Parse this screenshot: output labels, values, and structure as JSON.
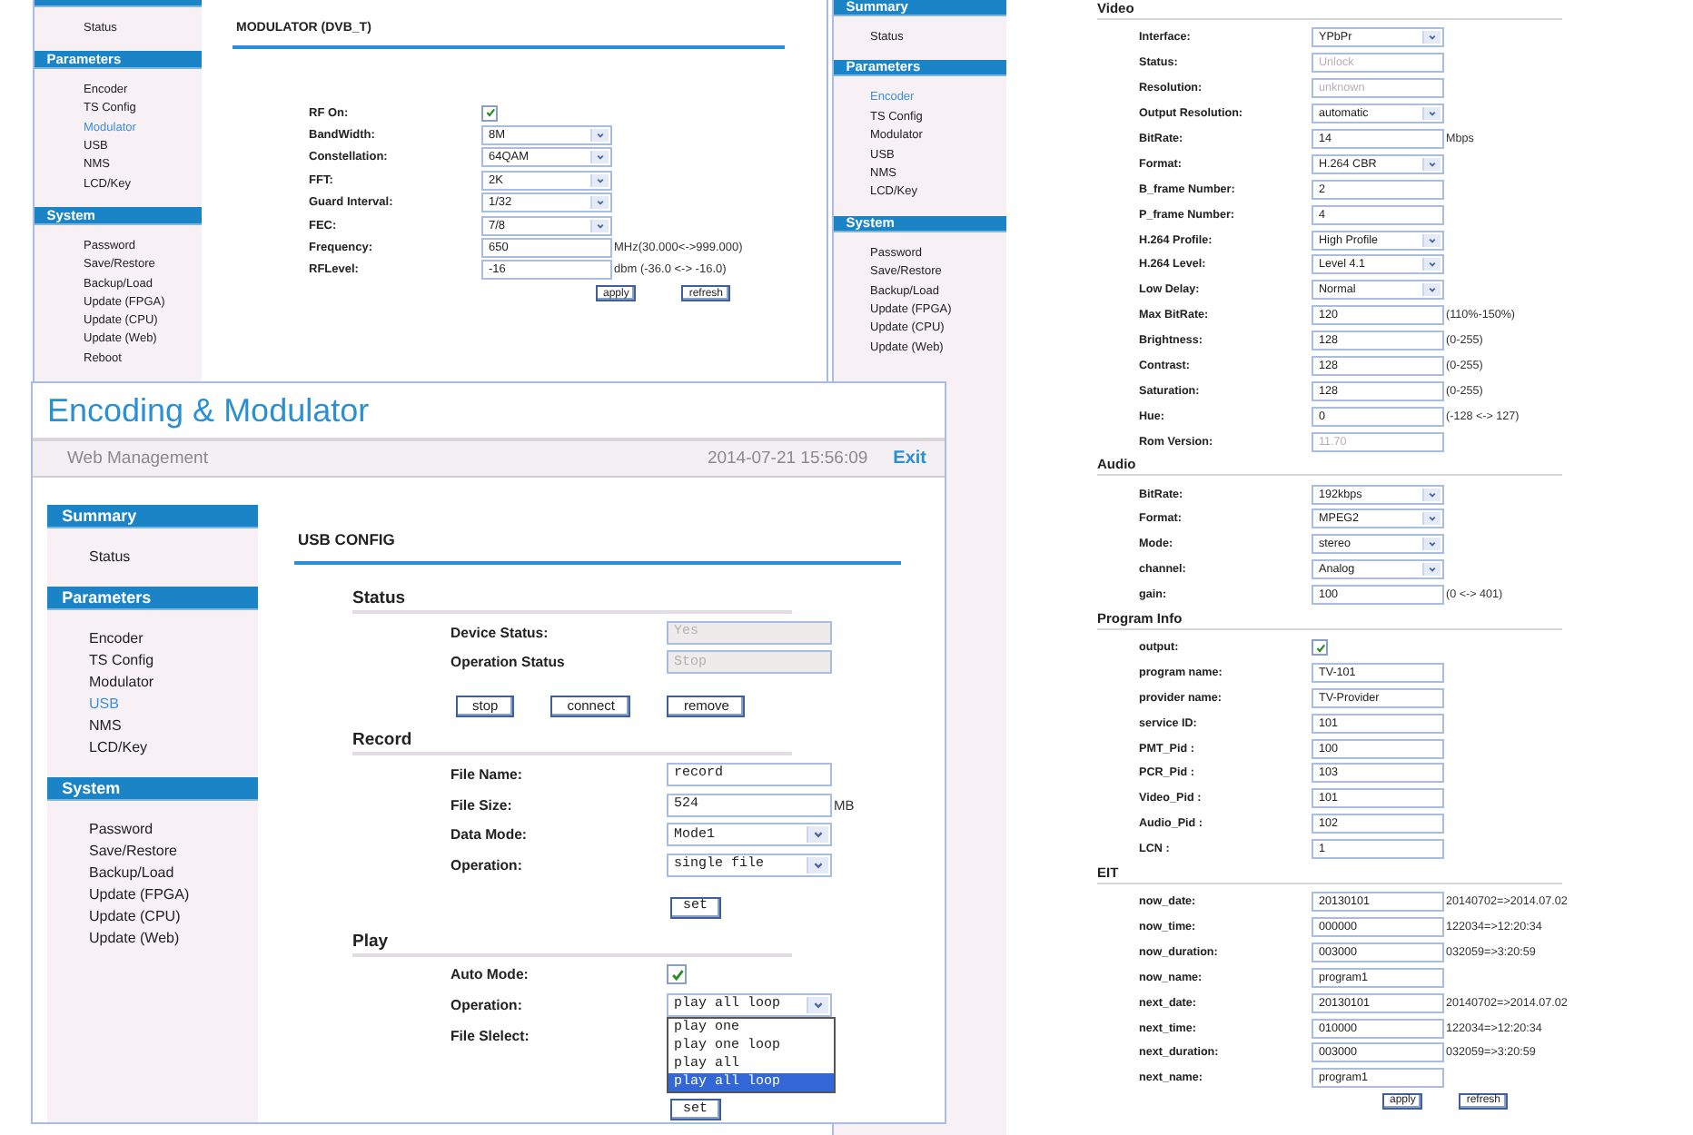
{
  "modulator_window": {
    "sidebar": [
      {
        "items": [
          {
            "label": "Status",
            "selected": false
          }
        ]
      },
      {
        "title": "Parameters",
        "items": [
          {
            "label": "Encoder",
            "selected": false
          },
          {
            "label": "TS Config",
            "selected": false
          },
          {
            "label": "Modulator",
            "selected": true
          },
          {
            "label": "USB",
            "selected": false
          },
          {
            "label": "NMS",
            "selected": false
          },
          {
            "label": "LCD/Key",
            "selected": false
          }
        ]
      },
      {
        "title": "System",
        "items": [
          {
            "label": "Password",
            "selected": false
          },
          {
            "label": "Save/Restore",
            "selected": false
          },
          {
            "label": "Backup/Load",
            "selected": false
          },
          {
            "label": "Update (FPGA)",
            "selected": false
          },
          {
            "label": "Update (CPU)",
            "selected": false
          },
          {
            "label": "Update (Web)",
            "selected": false
          },
          {
            "label": "Reboot",
            "selected": false
          }
        ]
      }
    ],
    "heading": "MODULATOR (DVB_T)",
    "fields": [
      {
        "kind": "checkbox",
        "label": "RF On:",
        "checked": true
      },
      {
        "kind": "select",
        "label": "BandWidth:",
        "value": "8M"
      },
      {
        "kind": "select",
        "label": "Constellation:",
        "value": "64QAM"
      },
      {
        "kind": "select",
        "label": "FFT:",
        "value": "2K"
      },
      {
        "kind": "select",
        "label": "Guard Interval:",
        "value": "1/32"
      },
      {
        "kind": "select",
        "label": "FEC:",
        "value": "7/8"
      },
      {
        "kind": "input",
        "label": "Frequency:",
        "value": "650",
        "hint": "MHz(30.000<->999.000)"
      },
      {
        "kind": "input",
        "label": "RFLevel:",
        "value": "-16",
        "hint": "dbm (-36.0 <-> -16.0)"
      }
    ],
    "buttons": [
      "apply",
      "refresh"
    ]
  },
  "encoder_window": {
    "sidebar": [
      {
        "title": "Summary",
        "items": [
          {
            "label": "Status",
            "selected": false
          }
        ]
      },
      {
        "title": "Parameters",
        "items": [
          {
            "label": "Encoder",
            "selected": true
          },
          {
            "label": "TS Config",
            "selected": false
          },
          {
            "label": "Modulator",
            "selected": false
          },
          {
            "label": "USB",
            "selected": false
          },
          {
            "label": "NMS",
            "selected": false
          },
          {
            "label": "LCD/Key",
            "selected": false
          }
        ]
      },
      {
        "title": "System",
        "items": [
          {
            "label": "Password",
            "selected": false
          },
          {
            "label": "Save/Restore",
            "selected": false
          },
          {
            "label": "Backup/Load",
            "selected": false
          },
          {
            "label": "Update (FPGA)",
            "selected": false
          },
          {
            "label": "Update (CPU)",
            "selected": false
          },
          {
            "label": "Update (Web)",
            "selected": false
          }
        ]
      }
    ],
    "groups": [
      {
        "title": "Video",
        "fields": [
          {
            "kind": "select",
            "label": "Interface:",
            "value": "YPbPr"
          },
          {
            "kind": "readonly",
            "label": "Status:",
            "value": "Unlock"
          },
          {
            "kind": "readonly",
            "label": "Resolution:",
            "value": "unknown"
          },
          {
            "kind": "select",
            "label": "Output Resolution:",
            "value": "automatic"
          },
          {
            "kind": "input",
            "label": "BitRate:",
            "value": "14",
            "hint": "Mbps"
          },
          {
            "kind": "select",
            "label": "Format:",
            "value": "H.264 CBR"
          },
          {
            "kind": "input",
            "label": "B_frame Number:",
            "value": "2"
          },
          {
            "kind": "input",
            "label": "P_frame Number:",
            "value": "4"
          },
          {
            "kind": "select",
            "label": "H.264 Profile:",
            "value": "High Profile"
          },
          {
            "kind": "select",
            "label": "H.264 Level:",
            "value": "Level 4.1"
          },
          {
            "kind": "select",
            "label": "Low Delay:",
            "value": "Normal"
          },
          {
            "kind": "input",
            "label": "Max BitRate:",
            "value": "120",
            "hint": "(110%-150%)"
          },
          {
            "kind": "input",
            "label": "Brightness:",
            "value": "128",
            "hint": "(0-255)"
          },
          {
            "kind": "input",
            "label": "Contrast:",
            "value": "128",
            "hint": "(0-255)"
          },
          {
            "kind": "input",
            "label": "Saturation:",
            "value": "128",
            "hint": "(0-255)"
          },
          {
            "kind": "input",
            "label": "Hue:",
            "value": "0",
            "hint": "(-128 <-> 127)"
          },
          {
            "kind": "readonly",
            "label": "Rom Version:",
            "value": "11.70"
          }
        ]
      },
      {
        "title": "Audio",
        "fields": [
          {
            "kind": "select",
            "label": "BitRate:",
            "value": "192kbps"
          },
          {
            "kind": "select",
            "label": "Format:",
            "value": "MPEG2"
          },
          {
            "kind": "select",
            "label": "Mode:",
            "value": "stereo"
          },
          {
            "kind": "select",
            "label": "channel:",
            "value": "Analog"
          },
          {
            "kind": "input",
            "label": "gain:",
            "value": "100",
            "hint": "(0 <-> 401)"
          }
        ]
      },
      {
        "title": "Program Info",
        "fields": [
          {
            "kind": "checkbox",
            "label": "output:",
            "checked": true
          },
          {
            "kind": "input",
            "label": "program name:",
            "value": "TV-101"
          },
          {
            "kind": "input",
            "label": "provider name:",
            "value": "TV-Provider"
          },
          {
            "kind": "input",
            "label": "service ID:",
            "value": "101"
          },
          {
            "kind": "input",
            "label": "PMT_Pid :",
            "value": "100"
          },
          {
            "kind": "input",
            "label": "PCR_Pid :",
            "value": "103"
          },
          {
            "kind": "input",
            "label": "Video_Pid :",
            "value": "101"
          },
          {
            "kind": "input",
            "label": "Audio_Pid :",
            "value": "102"
          },
          {
            "kind": "input",
            "label": "LCN :",
            "value": "1"
          }
        ]
      },
      {
        "title": "EIT",
        "fields": [
          {
            "kind": "input",
            "label": "now_date:",
            "value": "20130101",
            "hint": "20140702=>2014.07.02"
          },
          {
            "kind": "input",
            "label": "now_time:",
            "value": "000000",
            "hint": "122034=>12:20:34"
          },
          {
            "kind": "input",
            "label": "now_duration:",
            "value": "003000",
            "hint": "032059=>3:20:59"
          },
          {
            "kind": "input",
            "label": "now_name:",
            "value": "program1"
          },
          {
            "kind": "input",
            "label": "next_date:",
            "value": "20130101",
            "hint": "20140702=>2014.07.02"
          },
          {
            "kind": "input",
            "label": "next_time:",
            "value": "010000",
            "hint": "122034=>12:20:34"
          },
          {
            "kind": "input",
            "label": "next_duration:",
            "value": "003000",
            "hint": "032059=>3:20:59"
          },
          {
            "kind": "input",
            "label": "next_name:",
            "value": "program1"
          }
        ]
      }
    ],
    "buttons": [
      "apply",
      "refresh"
    ]
  },
  "usb_window": {
    "title": "Encoding & Modulator",
    "subtitle": "Web Management",
    "datetime": "2014-07-21 15:56:09",
    "exit": "Exit",
    "sidebar": [
      {
        "title": "Summary",
        "items": [
          {
            "label": "Status",
            "selected": false
          }
        ]
      },
      {
        "title": "Parameters",
        "items": [
          {
            "label": "Encoder",
            "selected": false
          },
          {
            "label": "TS Config",
            "selected": false
          },
          {
            "label": "Modulator",
            "selected": false
          },
          {
            "label": "USB",
            "selected": true
          },
          {
            "label": "NMS",
            "selected": false
          },
          {
            "label": "LCD/Key",
            "selected": false
          }
        ]
      },
      {
        "title": "System",
        "items": [
          {
            "label": "Password",
            "selected": false
          },
          {
            "label": "Save/Restore",
            "selected": false
          },
          {
            "label": "Backup/Load",
            "selected": false
          },
          {
            "label": "Update (FPGA)",
            "selected": false
          },
          {
            "label": "Update (CPU)",
            "selected": false
          },
          {
            "label": "Update (Web)",
            "selected": false
          }
        ]
      }
    ],
    "heading": "USB CONFIG",
    "groups": [
      {
        "title": "Status",
        "fields": [
          {
            "kind": "readonly",
            "label": "Device Status:",
            "value": "Yes"
          },
          {
            "kind": "readonly",
            "label": "Operation Status",
            "value": "Stop"
          }
        ],
        "buttons": [
          "stop",
          "connect",
          "remove"
        ]
      },
      {
        "title": "Record",
        "fields": [
          {
            "kind": "input",
            "label": "File Name:",
            "value": "record"
          },
          {
            "kind": "input",
            "label": "File Size:",
            "value": "524",
            "hint": "MB"
          },
          {
            "kind": "select",
            "label": "Data Mode:",
            "value": "Mode1"
          },
          {
            "kind": "select",
            "label": "Operation:",
            "value": "single file"
          }
        ],
        "buttons": [
          "set"
        ]
      },
      {
        "title": "Play",
        "fields": [
          {
            "kind": "checkbox",
            "label": "Auto Mode:",
            "checked": true
          },
          {
            "kind": "select",
            "label": "Operation:",
            "value": "play all loop",
            "expanded": true,
            "options": [
              {
                "label": "play one",
                "selected": false
              },
              {
                "label": "play one loop",
                "selected": false
              },
              {
                "label": "play all",
                "selected": false
              },
              {
                "label": "play all loop",
                "selected": true
              }
            ]
          },
          {
            "kind": "label",
            "label": "File Slelect:"
          }
        ],
        "buttons": [
          "set"
        ]
      }
    ]
  }
}
